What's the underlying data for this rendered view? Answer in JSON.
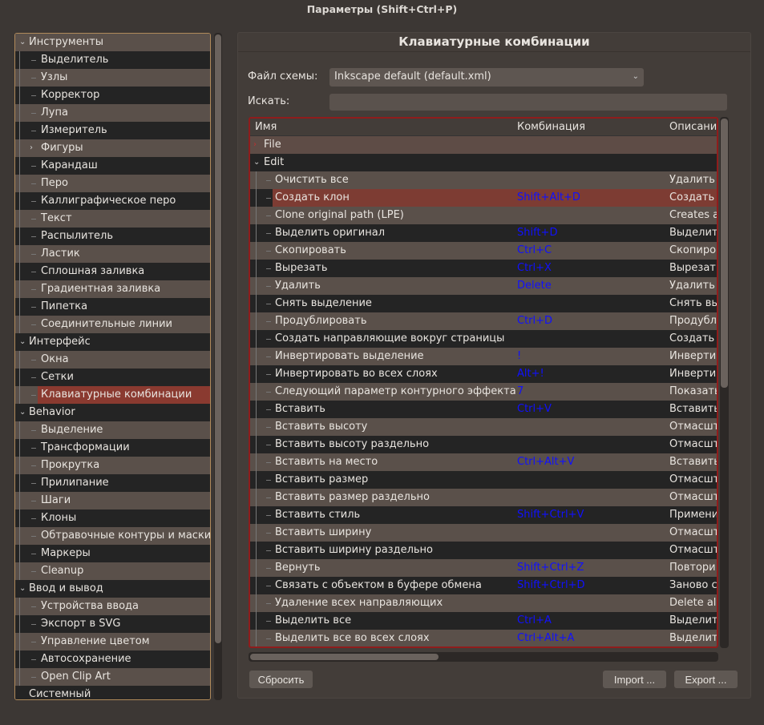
{
  "window": {
    "title": "Параметры (Shift+Ctrl+P)"
  },
  "sidebar": {
    "items": [
      {
        "label": "Инструменты",
        "level": 0,
        "expanded": true
      },
      {
        "label": "Выделитель",
        "level": 1
      },
      {
        "label": "Узлы",
        "level": 1
      },
      {
        "label": "Корректор",
        "level": 1
      },
      {
        "label": "Лупа",
        "level": 1
      },
      {
        "label": "Измеритель",
        "level": 1
      },
      {
        "label": "Фигуры",
        "level": 1,
        "expandable": true
      },
      {
        "label": "Карандаш",
        "level": 1
      },
      {
        "label": "Перо",
        "level": 1
      },
      {
        "label": "Каллиграфическое перо",
        "level": 1
      },
      {
        "label": "Текст",
        "level": 1
      },
      {
        "label": "Распылитель",
        "level": 1
      },
      {
        "label": "Ластик",
        "level": 1
      },
      {
        "label": "Сплошная заливка",
        "level": 1
      },
      {
        "label": "Градиентная заливка",
        "level": 1
      },
      {
        "label": "Пипетка",
        "level": 1
      },
      {
        "label": "Соединительные линии",
        "level": 1
      },
      {
        "label": "Интерфейс",
        "level": 0,
        "expanded": true
      },
      {
        "label": "Окна",
        "level": 1
      },
      {
        "label": "Сетки",
        "level": 1
      },
      {
        "label": "Клавиатурные комбинации",
        "level": 1,
        "selected": true
      },
      {
        "label": "Behavior",
        "level": 0,
        "expanded": true
      },
      {
        "label": "Выделение",
        "level": 1
      },
      {
        "label": "Трансформации",
        "level": 1
      },
      {
        "label": "Прокрутка",
        "level": 1
      },
      {
        "label": "Прилипание",
        "level": 1
      },
      {
        "label": "Шаги",
        "level": 1
      },
      {
        "label": "Клоны",
        "level": 1
      },
      {
        "label": "Обтравочные контуры и маски",
        "level": 1
      },
      {
        "label": "Маркеры",
        "level": 1
      },
      {
        "label": "Cleanup",
        "level": 1
      },
      {
        "label": "Ввод и вывод",
        "level": 0,
        "expanded": true
      },
      {
        "label": "Устройства ввода",
        "level": 1
      },
      {
        "label": "Экспорт в SVG",
        "level": 1
      },
      {
        "label": "Управление цветом",
        "level": 1
      },
      {
        "label": "Автосохранение",
        "level": 1
      },
      {
        "label": "Open Clip Art",
        "level": 1
      },
      {
        "label": "Системный",
        "level": 0
      }
    ]
  },
  "main": {
    "title": "Клавиатурные комбинации",
    "scheme_label": "Файл схемы:",
    "scheme_value": "Inkscape default (default.xml)",
    "search_label": "Искать:",
    "search_value": "",
    "columns": [
      "Имя",
      "Комбинация",
      "Описани"
    ],
    "groups": [
      {
        "label": "File",
        "expanded": false
      },
      {
        "label": "Edit",
        "expanded": true
      }
    ],
    "rows": [
      [
        "Очистить все",
        "",
        "Удалить"
      ],
      [
        "Создать клон",
        "Shift+Alt+D",
        "Создать к"
      ],
      [
        "Clone original path (LPE)",
        "",
        "Creates a"
      ],
      [
        "Выделить оригинал",
        "Shift+D",
        "Выделит"
      ],
      [
        "Скопировать",
        "Ctrl+C",
        "Скопиров"
      ],
      [
        "Вырезать",
        "Ctrl+X",
        "Вырезат"
      ],
      [
        "Удалить",
        "Delete",
        "Удалить"
      ],
      [
        "Снять выделение",
        "",
        "Снять вы"
      ],
      [
        "Продублировать",
        "Ctrl+D",
        "Продубл"
      ],
      [
        "Создать направляющие вокруг страницы",
        "",
        "Создать"
      ],
      [
        "Инвертировать выделение",
        "!",
        "Инверти"
      ],
      [
        "Инвертировать во всех слоях",
        "Alt+!",
        "Инверти"
      ],
      [
        "Следующий параметр контурного эффекта",
        "7",
        "Показать"
      ],
      [
        "Вставить",
        "Ctrl+V",
        "Вставить"
      ],
      [
        "Вставить высоту",
        "",
        "Отмасшт"
      ],
      [
        "Вставить высоту раздельно",
        "",
        "Отмасшт"
      ],
      [
        "Вставить на место",
        "Ctrl+Alt+V",
        "Вставить"
      ],
      [
        "Вставить размер",
        "",
        "Отмасшт"
      ],
      [
        "Вставить размер раздельно",
        "",
        "Отмасшт"
      ],
      [
        "Вставить стиль",
        "Shift+Ctrl+V",
        "Примени"
      ],
      [
        "Вставить ширину",
        "",
        "Отмасшт"
      ],
      [
        "Вставить ширину раздельно",
        "",
        "Отмасшт"
      ],
      [
        "Вернуть",
        "Shift+Ctrl+Z",
        "Повтори"
      ],
      [
        "Связать с объектом в буфере обмена",
        "Shift+Ctrl+D",
        "Заново с"
      ],
      [
        "Удаление всех направляющих",
        "",
        "Delete al"
      ],
      [
        "Выделить все",
        "Ctrl+A",
        "Выделит"
      ],
      [
        "Выделить все во всех слоях",
        "Ctrl+Alt+A",
        "Выделит"
      ]
    ],
    "selected_row": 1,
    "buttons": {
      "reset": "Сбросить",
      "import": "Import ...",
      "export": "Export ..."
    }
  },
  "colors": {
    "selection": "#8a3a30",
    "shortcut": "#1010ff",
    "tree_border": "#b08a5a",
    "table_border": "#8f1c1c"
  }
}
